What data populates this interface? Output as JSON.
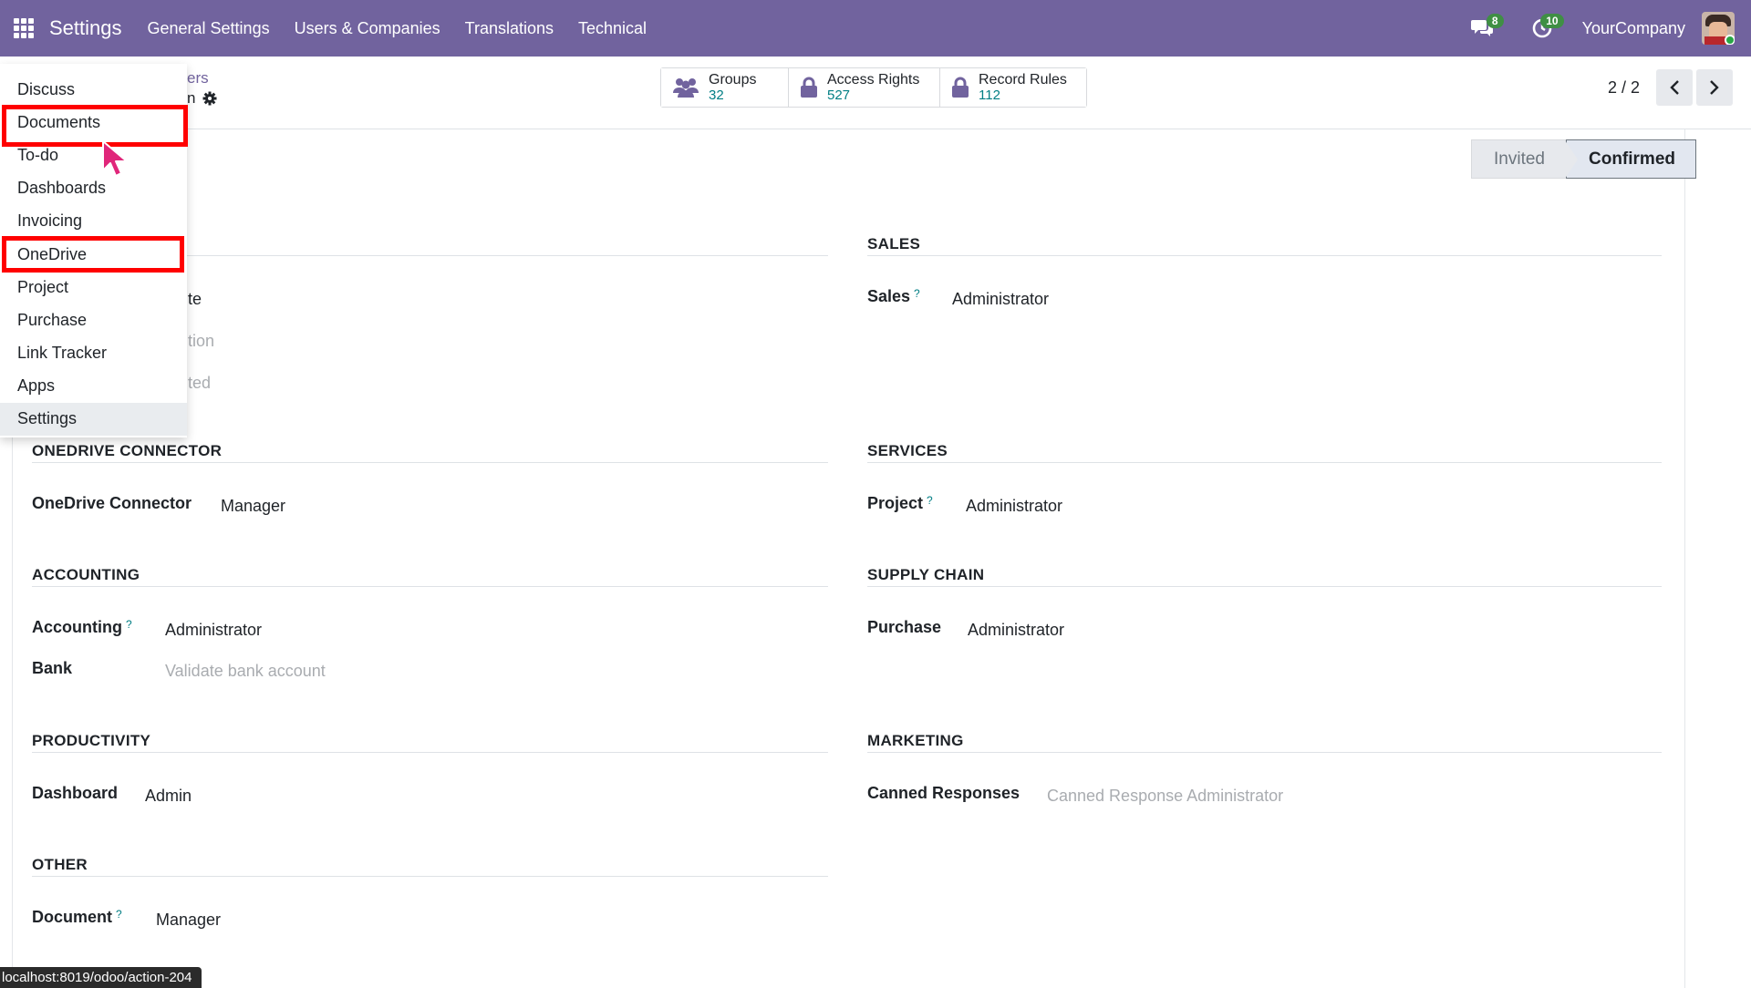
{
  "navbar": {
    "app_title": "Settings",
    "menus": [
      "General Settings",
      "Users & Companies",
      "Translations",
      "Technical"
    ],
    "messages_count": "8",
    "activities_count": "10",
    "company": "YourCompany"
  },
  "control_panel": {
    "breadcrumb_fragment": "ers",
    "record_fragment": "n",
    "smart_buttons": [
      {
        "label": "Groups",
        "value": "32",
        "icon": "users-icon"
      },
      {
        "label": "Access Rights",
        "value": "527",
        "icon": "lock-icon"
      },
      {
        "label": "Record Rules",
        "value": "112",
        "icon": "lock-icon"
      }
    ],
    "pager": "2 / 2"
  },
  "statusbar": {
    "stages": [
      "Invited",
      "Confirmed"
    ],
    "current": "Confirmed"
  },
  "hidden_fragments": {
    "frag1": "te",
    "frag2": "tion",
    "frag3": "ted"
  },
  "sections": {
    "onedrive": {
      "title": "ONEDRIVE CONNECTOR",
      "label": "OneDrive Connector",
      "value": "Manager"
    },
    "accounting": {
      "title": "ACCOUNTING",
      "label": "Accounting",
      "value": "Administrator",
      "bank_label": "Bank",
      "bank_placeholder": "Validate bank account"
    },
    "productivity": {
      "title": "PRODUCTIVITY",
      "label": "Dashboard",
      "value": "Admin"
    },
    "other": {
      "title": "OTHER",
      "label": "Document",
      "value": "Manager"
    },
    "sales": {
      "title": "SALES",
      "label": "Sales",
      "value": "Administrator"
    },
    "services": {
      "title": "SERVICES",
      "label": "Project",
      "value": "Administrator"
    },
    "supply_chain": {
      "title": "SUPPLY CHAIN",
      "label": "Purchase",
      "value": "Administrator"
    },
    "marketing": {
      "title": "MARKETING",
      "label": "Canned Responses",
      "placeholder": "Canned Response Administrator"
    }
  },
  "help_marker": "?",
  "apps_dropdown": {
    "items": [
      "Discuss",
      "Documents",
      "To-do",
      "Dashboards",
      "Invoicing",
      "OneDrive",
      "Project",
      "Purchase",
      "Link Tracker",
      "Apps",
      "Settings"
    ],
    "highlighted": [
      "Documents",
      "OneDrive"
    ],
    "active": "Settings"
  },
  "status_url": "localhost:8019/odoo/action-204",
  "colors": {
    "navbar": "#71639e",
    "highlight": "#ff0000",
    "cursor": "#e0267a",
    "link": "#017e84"
  }
}
